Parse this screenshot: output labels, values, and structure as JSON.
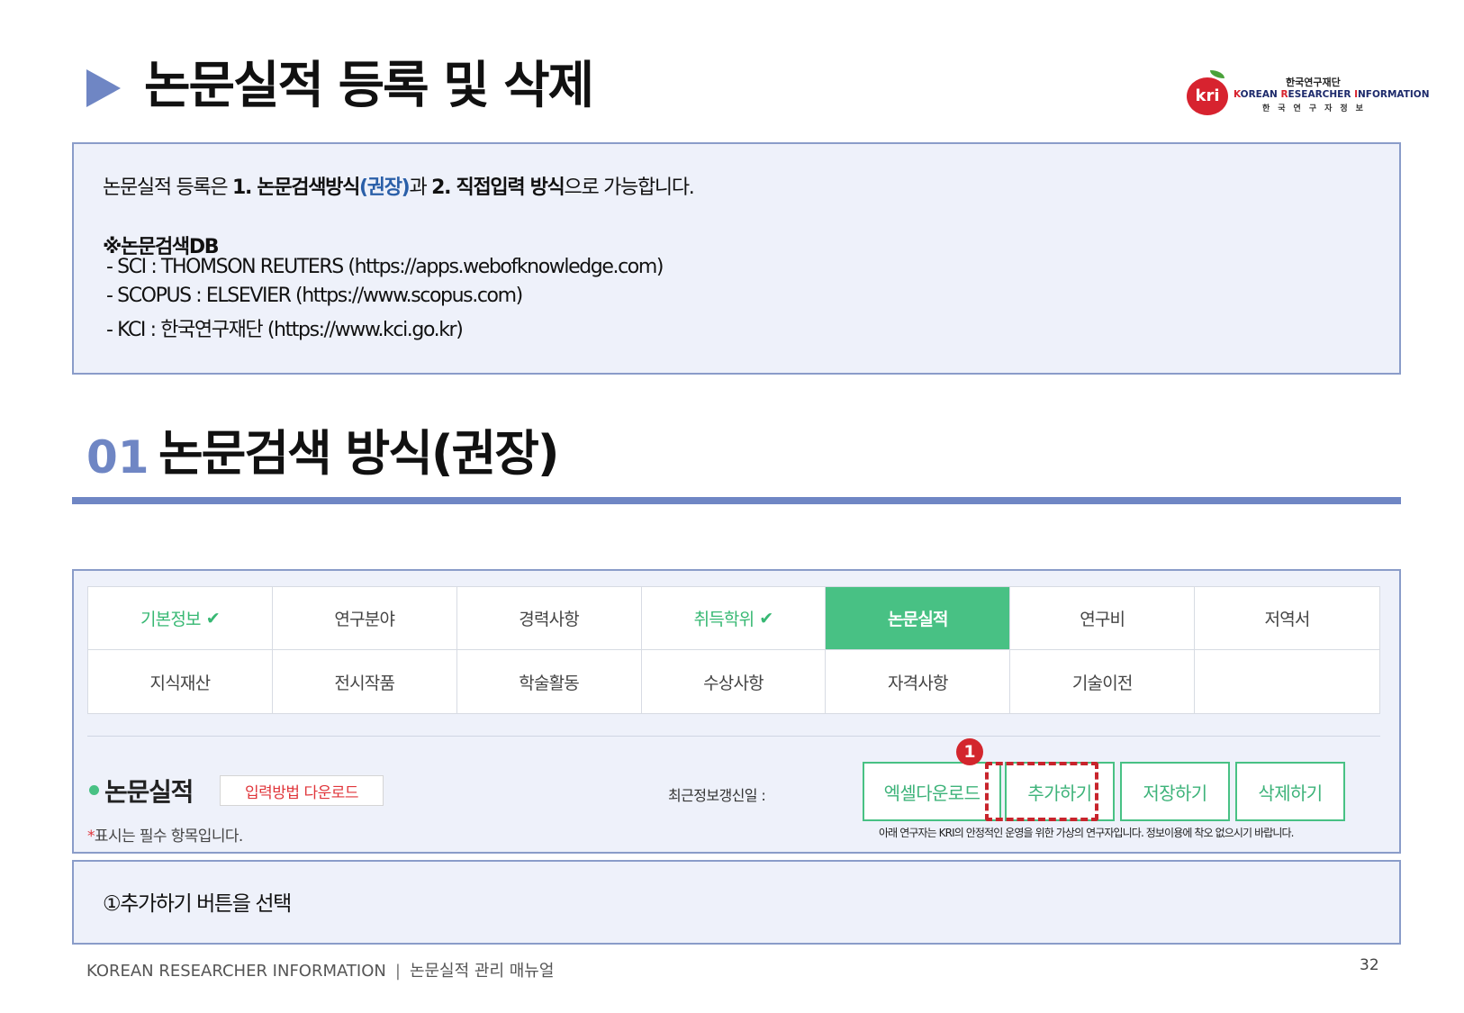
{
  "header": {
    "title": "논문실적 등록 및 삭제",
    "logo": {
      "mark_text": "kri",
      "ko": "한국연구재단",
      "en_k": "K",
      "en_orean": "OREAN ",
      "en_r": "R",
      "en_esearcher": "ESEARCHER ",
      "en_i": "I",
      "en_nformation": "NFORMATION",
      "sub": "한국연구자정보"
    }
  },
  "intro": {
    "line1_a": "논문실적 등록은 ",
    "line1_b": "1. 논문검색방식",
    "line1_c": "(권장)",
    "line1_d": "과 ",
    "line1_e": "2. 직접입력 방식",
    "line1_f": "으로 가능합니다.",
    "db_heading": "※논문검색DB",
    "db_items": [
      "- SCI : THOMSON REUTERS (https://apps.webofknowledge.com)",
      "- SCOPUS : ELSEVIER (https://www.scopus.com)",
      "- KCI : 한국연구재단 (https://www.kci.go.kr)"
    ]
  },
  "section": {
    "number": "01",
    "title": "논문검색 방식(권장)"
  },
  "screen": {
    "tabs": [
      {
        "label": "기본정보",
        "check": "✔"
      },
      {
        "label": "연구분야"
      },
      {
        "label": "경력사항"
      },
      {
        "label": "취득학위",
        "check": "✔"
      },
      {
        "label": "논문실적"
      },
      {
        "label": "연구비"
      },
      {
        "label": "저역서"
      },
      {
        "label": "지식재산"
      },
      {
        "label": "전시작품"
      },
      {
        "label": "학술활동"
      },
      {
        "label": "수상사항"
      },
      {
        "label": "자격사항"
      },
      {
        "label": "기술이전"
      }
    ],
    "sub_title": "논문실적",
    "download_label": "입력방법 다운로드",
    "required_star": "*",
    "required_note": "표시는 필수 항목입니다.",
    "update_label": "최근정보갱신일 :",
    "buttons": {
      "excel": "엑셀다운로드",
      "add": "추가하기",
      "save": "저장하기",
      "delete": "삭제하기"
    },
    "step_badge": "1",
    "fine_print": "아래 연구자는 KRI의 안정적인 운영을 위한 가상의 연구자입니다. 정보이용에 착오 없으시기 바랍니다."
  },
  "step": {
    "text": "①추가하기 버튼을 선택"
  },
  "footer": {
    "org": "KOREAN RESEARCHER INFORMATION",
    "separator": "|",
    "manual": "논문실적 관리 매뉴얼",
    "page": "32"
  },
  "colors": {
    "accent_blue": "#6f86c4",
    "box_fill": "#eef1fa",
    "green": "#48c184",
    "red_highlight": "#c8242c",
    "logo_red": "#d7232f"
  }
}
